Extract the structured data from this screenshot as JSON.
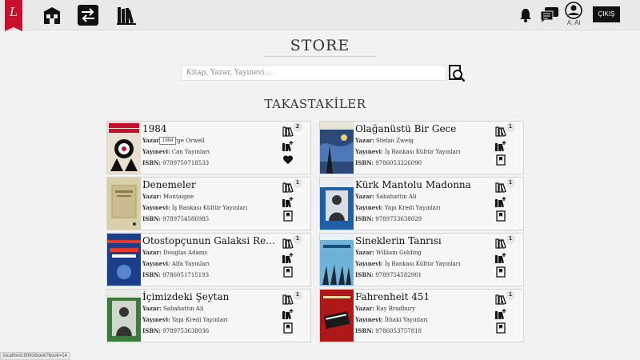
{
  "nav": {
    "logo_letter": "L",
    "user_label": "A. Al",
    "logout_label": "ÇIKIŞ"
  },
  "page": {
    "title": "STORE",
    "search_placeholder": "Kitap, Yazar, Yayınevi...",
    "section_title": "TAKASTAKİLER"
  },
  "labels": {
    "author": "Yazar:",
    "publisher": "Yayınevi:",
    "isbn": "ISBN:"
  },
  "books": [
    {
      "title": "1984",
      "author": "George Orwell",
      "publisher": "Can Yayınları",
      "isbn": "9789750718533",
      "count": "2",
      "third_icon": "heart-icon",
      "cover_color": "#e8e1d2"
    },
    {
      "title": "Olağanüstü Bir Gece",
      "author": "Stefan Zweig",
      "publisher": "İş Bankası Kültür Yayınları",
      "isbn": "9786053326090",
      "count": "1",
      "third_icon": "bookmark-icon",
      "cover_color": "#2b4a7a"
    },
    {
      "title": "Denemeler",
      "author": "Montaigne",
      "publisher": "İş Bankası Kültür Yayınları",
      "isbn": "9789754586985",
      "count": "1",
      "third_icon": "bookmark-icon",
      "cover_color": "#d9cfa8"
    },
    {
      "title": "Kürk Mantolu Madonna",
      "author": "Sabahattin Ali",
      "publisher": "Yapı Kredi Yayınları",
      "isbn": "9789753638029",
      "count": "1",
      "third_icon": "bookmark-icon",
      "cover_color": "#1f5fa8"
    },
    {
      "title": "Otostopçunun Galaksi Rehberi-...",
      "author": "Douglas Adams",
      "publisher": "Alfa Yayınları",
      "isbn": "9786051715193",
      "count": "1",
      "third_icon": "bookmark-icon",
      "cover_color": "#1c3f8c"
    },
    {
      "title": "Sineklerin Tanrısı",
      "author": "William Golding",
      "publisher": "İş Bankası Kültür Yayınları",
      "isbn": "9789754582901",
      "count": "1",
      "third_icon": "bookmark-icon",
      "cover_color": "#6fb3d9"
    },
    {
      "title": "İçimizdeki Şeytan",
      "author": "Sabahattin Ali",
      "publisher": "Yapı Kredi Yayınları",
      "isbn": "9789753638036",
      "count": "1",
      "third_icon": "bookmark-icon",
      "cover_color": "#3d7a3d"
    },
    {
      "title": "Fahrenheit 451",
      "author": "Ray Bradbury",
      "publisher": "İthaki Yayınları",
      "isbn": "9786053757818",
      "count": "1",
      "third_icon": "bookmark-icon",
      "cover_color": "#b01818"
    }
  ],
  "tooltip": "1984",
  "status_url": "localhost:8000/book?book=14"
}
